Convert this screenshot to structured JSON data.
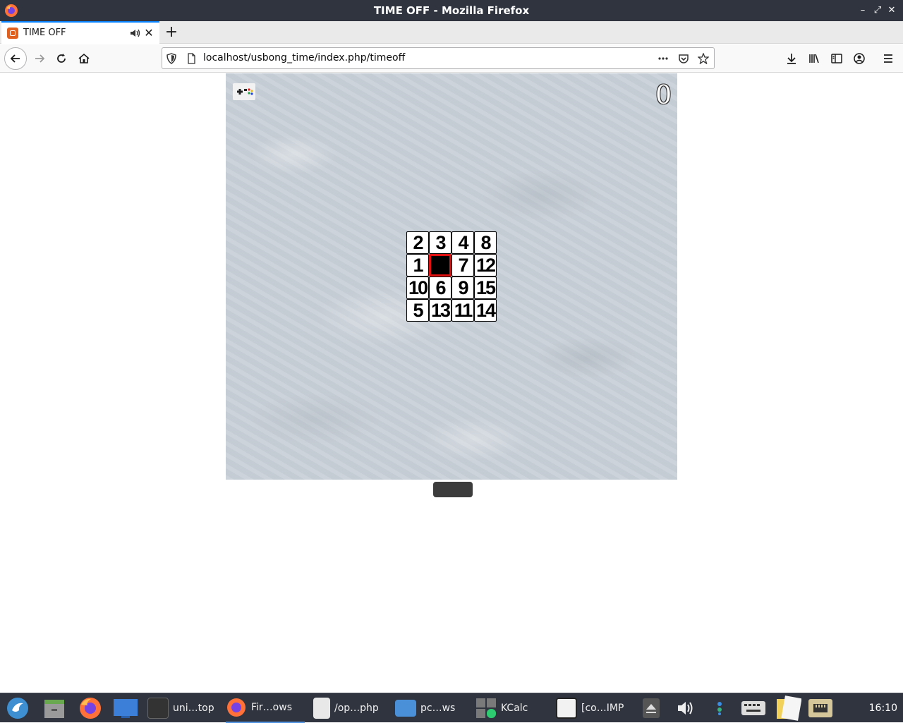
{
  "window": {
    "title": "TIME OFF - Mozilla Firefox",
    "controls": [
      "minimize",
      "maximize",
      "close"
    ]
  },
  "tab": {
    "label": "TIME OFF",
    "new_tab_label": "+"
  },
  "navbar": {
    "url": "localhost/usbong_time/index.php/timeoff"
  },
  "game": {
    "score": "0",
    "selected_cell": "blank",
    "tiles": [
      "2",
      "3",
      "4",
      "8",
      "1",
      "",
      "7",
      "12",
      "10",
      "6",
      "9",
      "15",
      "5",
      "13",
      "11",
      "14"
    ]
  },
  "taskbar": {
    "items": [
      {
        "label": "uni…top",
        "icon": "terminal-icon"
      },
      {
        "label": "Fir…ows",
        "icon": "firefox-icon",
        "active": true
      },
      {
        "label": "/op…php",
        "icon": "text-editor-icon"
      },
      {
        "label": "pc…ws",
        "icon": "folder-icon"
      },
      {
        "label": "KCalc",
        "icon": "calculator-icon"
      },
      {
        "label": "[co…IMP",
        "icon": "gimp-image-icon"
      }
    ],
    "clock": "16:10"
  },
  "colors": {
    "titlebar": "#2f343f",
    "accent": "#0a84ff",
    "selected_tile_border": "#e01010"
  }
}
